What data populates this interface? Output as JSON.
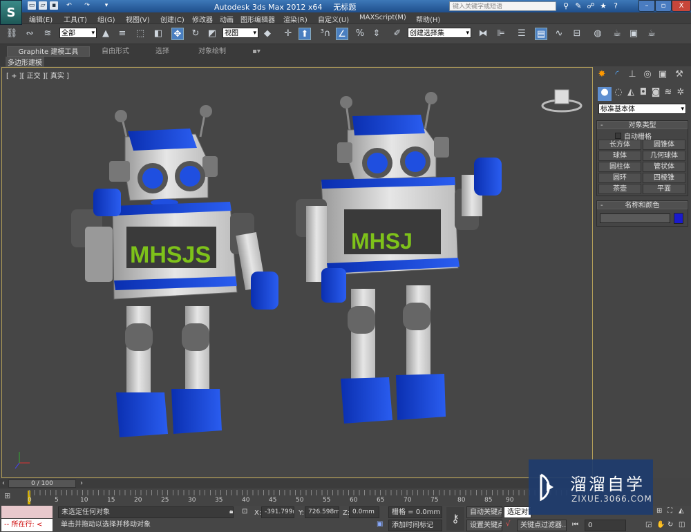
{
  "app": {
    "title": "Autodesk 3ds Max  2012 x64",
    "doc": "无标题",
    "logo": "S"
  },
  "search": {
    "placeholder": "键入关键字或短语"
  },
  "menu": [
    "编辑(E)",
    "工具(T)",
    "组(G)",
    "视图(V)",
    "创建(C)",
    "修改器",
    "动画",
    "图形编辑器",
    "渲染(R)",
    "自定义(U)",
    "MAXScript(M)",
    "帮助(H)"
  ],
  "toolbar": {
    "selection_filter": "全部",
    "ref_coord": "视图",
    "named_selection": "创建选择集"
  },
  "ribbon": {
    "tabs": [
      "Graphite 建模工具",
      "自由形式",
      "选择",
      "对象绘制"
    ],
    "sub": "多边形建模"
  },
  "viewport": {
    "label": "[ + ][ 正交 ][ 真实 ]",
    "text_left": "MHSJS",
    "text_right": "MHSJ"
  },
  "command_panel": {
    "category": "标准基本体",
    "object_type": {
      "title": "对象类型",
      "autogrid": "自动栅格",
      "buttons": [
        "长方体",
        "圆锥体",
        "球体",
        "几何球体",
        "圆柱体",
        "管状体",
        "圆环",
        "四棱锥",
        "茶壶",
        "平面"
      ]
    },
    "name_color": {
      "title": "名称和颜色",
      "name": "",
      "color": "#1a1acc"
    }
  },
  "timeline": {
    "frame": "0 / 100",
    "ticks": [
      "0",
      "5",
      "10",
      "15",
      "20",
      "25",
      "30",
      "35",
      "40",
      "45",
      "50",
      "55",
      "60",
      "65",
      "70",
      "75",
      "80",
      "85",
      "90"
    ]
  },
  "status": {
    "script_label": "所在行:",
    "selection": "未选定任何对象",
    "prompt": "单击并拖动以选择并移动对象",
    "x": "-391.799m",
    "y": "726.598mm",
    "z": "0.0mm",
    "grid": "栅格 = 0.0mm",
    "add_time_tag": "添加时间标记",
    "auto_key": "自动关键点",
    "set_key": "设置关键点",
    "selected": "选定对象",
    "key_filters": "关键点过滤器...",
    "current_frame": "0"
  },
  "watermark": {
    "name": "溜溜自学",
    "url": "ZIXUE.3066.COM"
  }
}
